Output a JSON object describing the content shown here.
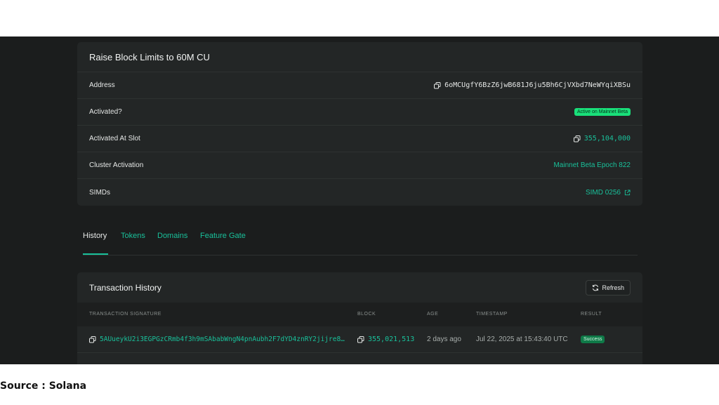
{
  "feature": {
    "title": "Raise Block Limits to 60M CU",
    "rows": [
      {
        "label": "Address",
        "value": "6oMCUgfY6BzZ6jwB681J6ju5Bh6CjVXbd7NeWYqiXBSu"
      },
      {
        "label": "Activated?",
        "value": "Active on Mainnet Beta"
      },
      {
        "label": "Activated At Slot",
        "value": "355,104,000"
      },
      {
        "label": "Cluster Activation",
        "value": "Mainnet Beta Epoch 822"
      },
      {
        "label": "SIMDs",
        "value": "SIMD 0256"
      }
    ]
  },
  "tabs": [
    {
      "label": "History",
      "active": true
    },
    {
      "label": "Tokens"
    },
    {
      "label": "Domains"
    },
    {
      "label": "Feature Gate"
    }
  ],
  "history": {
    "title": "Transaction History",
    "refresh_label": "Refresh",
    "columns": [
      "TRANSACTION SIGNATURE",
      "BLOCK",
      "AGE",
      "TIMESTAMP",
      "RESULT"
    ],
    "rows": [
      {
        "signature": "5AUueykU2i3EGPGzCRmb4f3h9mSAbabWngN4pnAubh2F7dYD4znRY2jijre8…",
        "block": "355,021,513",
        "age": "2 days ago",
        "timestamp": "Jul 22, 2025 at 15:43:40 UTC",
        "result": "Success"
      }
    ]
  },
  "source": "Source : Solana",
  "colors": {
    "accent": "#19c09a",
    "badge_green": "#19e07a",
    "success": "#0f7a48",
    "background": "#1b1d1d",
    "card": "#232626"
  }
}
